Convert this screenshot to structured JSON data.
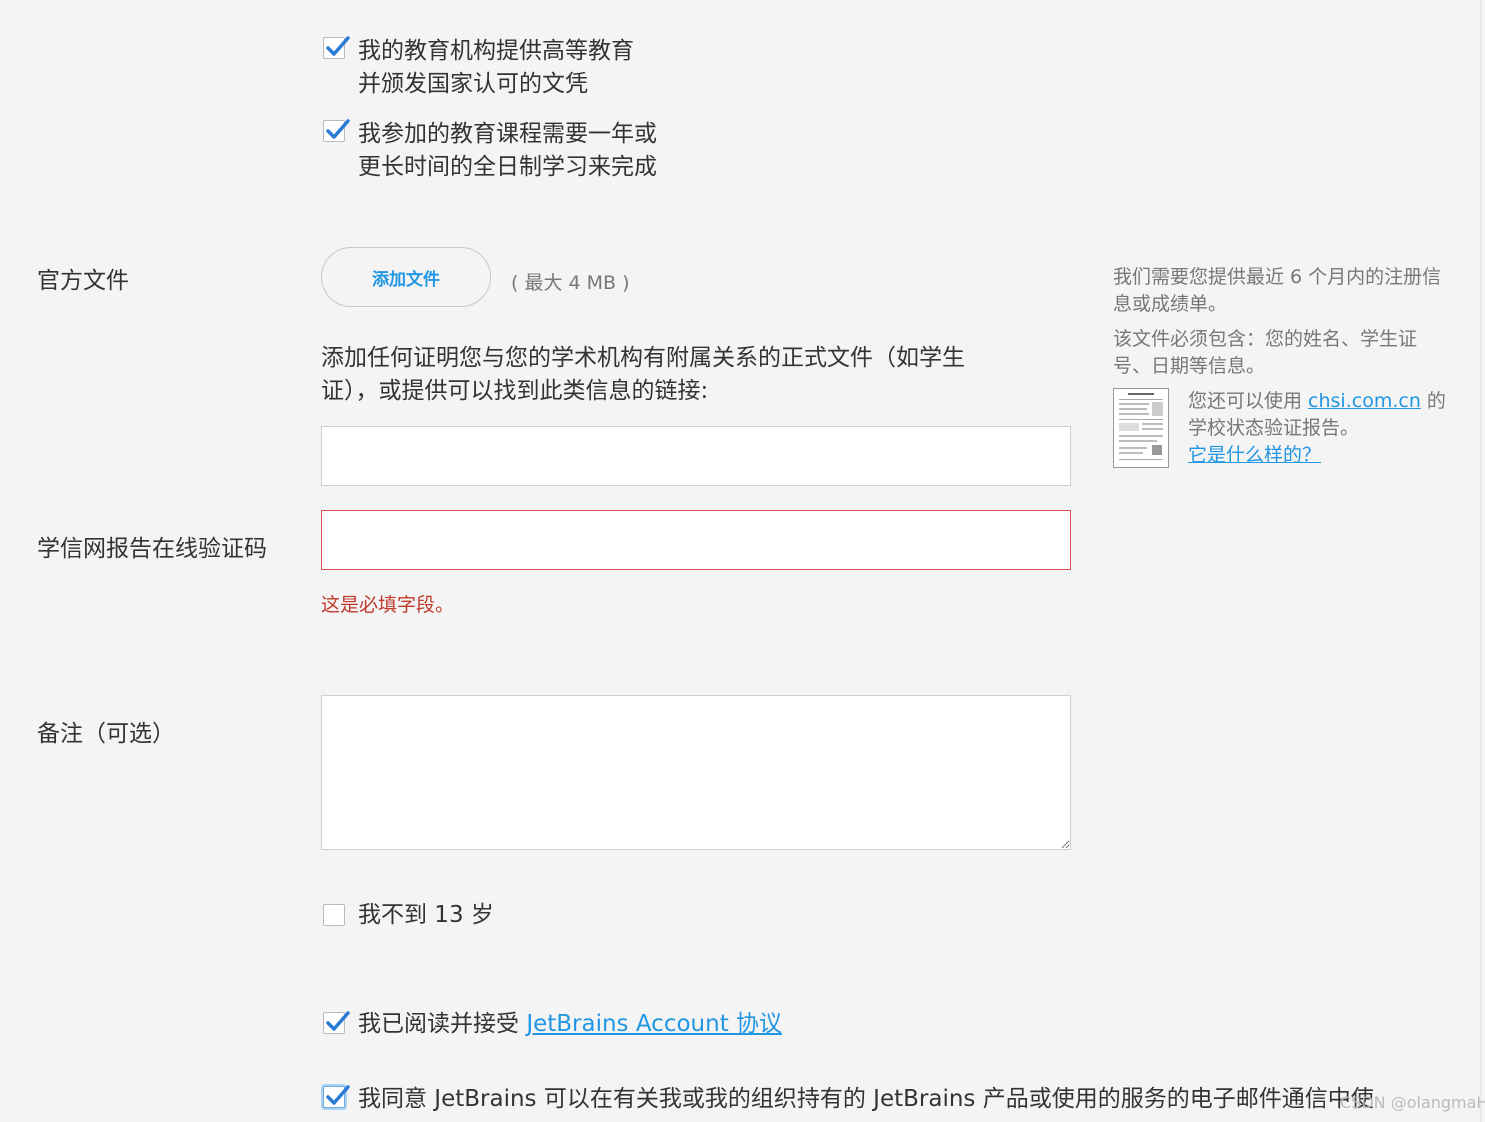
{
  "eligibility": {
    "check1": {
      "line1": "我的教育机构提供高等教育",
      "line2": "并颁发国家认可的文凭",
      "checked": true
    },
    "check2": {
      "line1": "我参加的教育课程需要一年或",
      "line2": "更长时间的全日制学习来完成",
      "checked": true
    }
  },
  "official_docs": {
    "label": "官方文件",
    "add_file_button": "添加文件",
    "max_size": "( 最大 4 MB )",
    "description": "添加任何证明您与您的学术机构有附属关系的正式文件（如学生证），或提供可以找到此类信息的链接:",
    "link_input_value": ""
  },
  "verification": {
    "label": "学信网报告在线验证码",
    "input_value": "",
    "error": "这是必填字段。"
  },
  "notes": {
    "label": "备注（可选）",
    "value": ""
  },
  "sidebar": {
    "para1": "我们需要您提供最近 6 个月内的注册信息或成绩单。",
    "para2": "该文件必须包含：您的姓名、学生证号、日期等信息。",
    "para3_prefix": "您还可以使用 ",
    "para3_link": "chsi.com.cn",
    "para3_suffix": " 的学校状态验证报告。",
    "what_link": "它是什么样的？"
  },
  "under13": {
    "label": "我不到 13 岁",
    "checked": false
  },
  "agreement": {
    "prefix": "我已阅读并接受 ",
    "link": "JetBrains Account 协议",
    "checked": true
  },
  "consent": {
    "text": "我同意 JetBrains 可以在有关我或我的组织持有的 JetBrains 产品或使用的服务的电子邮件通信中使",
    "checked": true
  },
  "watermark": "CSDN @olangmaH"
}
